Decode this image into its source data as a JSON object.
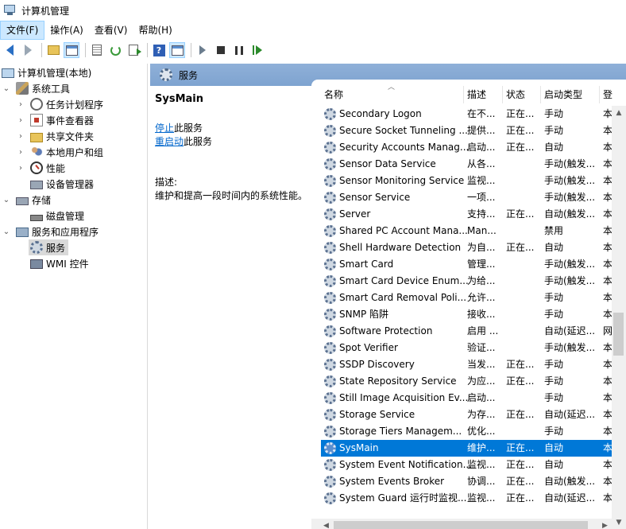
{
  "window": {
    "title": "计算机管理"
  },
  "menu": [
    {
      "label": "文件(F)",
      "active": true
    },
    {
      "label": "操作(A)",
      "active": false
    },
    {
      "label": "查看(V)",
      "active": false
    },
    {
      "label": "帮助(H)",
      "active": false
    }
  ],
  "toolbar": {
    "icons": [
      "back-arrow-icon",
      "forward-arrow-icon",
      "up-folder-icon",
      "show-hide-tree-icon",
      "properties-icon",
      "refresh-icon",
      "export-list-icon",
      "help-icon",
      "action-pane-icon",
      "start-service-icon",
      "stop-service-icon",
      "pause-service-icon",
      "restart-service-icon"
    ],
    "help_glyph": "?"
  },
  "tree": {
    "items": [
      {
        "label": "计算机管理(本地)",
        "icon": "computer-icon"
      },
      {
        "label": "系统工具",
        "icon": "tools-icon"
      },
      {
        "label": "任务计划程序",
        "icon": "clock-icon"
      },
      {
        "label": "事件查看器",
        "icon": "event-viewer-icon"
      },
      {
        "label": "共享文件夹",
        "icon": "shared-folder-icon"
      },
      {
        "label": "本地用户和组",
        "icon": "users-icon"
      },
      {
        "label": "性能",
        "icon": "performance-icon"
      },
      {
        "label": "设备管理器",
        "icon": "device-manager-icon"
      },
      {
        "label": "存储",
        "icon": "storage-icon"
      },
      {
        "label": "磁盘管理",
        "icon": "disk-icon"
      },
      {
        "label": "服务和应用程序",
        "icon": "apps-icon"
      },
      {
        "label": "服务",
        "icon": "gear-icon"
      },
      {
        "label": "WMI 控件",
        "icon": "wmi-icon"
      }
    ]
  },
  "services_panel": {
    "header_title": "服务",
    "selected_name": "SysMain",
    "stop_link": "停止",
    "stop_suffix": "此服务",
    "restart_link": "重启动",
    "restart_suffix": "此服务",
    "description_label": "描述:",
    "description_text": "维护和提高一段时间内的系统性能。"
  },
  "columns": {
    "name": "名称",
    "description": "描述",
    "status": "状态",
    "startup": "启动类型",
    "logon": "登"
  },
  "services": [
    {
      "name": "Secondary Logon",
      "desc": "在不...",
      "status": "正在...",
      "startup": "手动",
      "logon": "本"
    },
    {
      "name": "Secure Socket Tunneling ...",
      "desc": "提供...",
      "status": "正在...",
      "startup": "手动",
      "logon": "本"
    },
    {
      "name": "Security Accounts Manag...",
      "desc": "启动...",
      "status": "正在...",
      "startup": "自动",
      "logon": "本"
    },
    {
      "name": "Sensor Data Service",
      "desc": "从各...",
      "status": "",
      "startup": "手动(触发...",
      "logon": "本"
    },
    {
      "name": "Sensor Monitoring Service",
      "desc": "监视...",
      "status": "",
      "startup": "手动(触发...",
      "logon": "本"
    },
    {
      "name": "Sensor Service",
      "desc": "一项...",
      "status": "",
      "startup": "手动(触发...",
      "logon": "本"
    },
    {
      "name": "Server",
      "desc": "支持...",
      "status": "正在...",
      "startup": "自动(触发...",
      "logon": "本"
    },
    {
      "name": "Shared PC Account Mana...",
      "desc": "Man...",
      "status": "",
      "startup": "禁用",
      "logon": "本"
    },
    {
      "name": "Shell Hardware Detection",
      "desc": "为自...",
      "status": "正在...",
      "startup": "自动",
      "logon": "本"
    },
    {
      "name": "Smart Card",
      "desc": "管理...",
      "status": "",
      "startup": "手动(触发...",
      "logon": "本"
    },
    {
      "name": "Smart Card Device Enum...",
      "desc": "为给...",
      "status": "",
      "startup": "手动(触发...",
      "logon": "本"
    },
    {
      "name": "Smart Card Removal Poli...",
      "desc": "允许...",
      "status": "",
      "startup": "手动",
      "logon": "本"
    },
    {
      "name": "SNMP 陷阱",
      "desc": "接收...",
      "status": "",
      "startup": "手动",
      "logon": "本"
    },
    {
      "name": "Software Protection",
      "desc": "启用 ...",
      "status": "",
      "startup": "自动(延迟...",
      "logon": "网"
    },
    {
      "name": "Spot Verifier",
      "desc": "验证...",
      "status": "",
      "startup": "手动(触发...",
      "logon": "本"
    },
    {
      "name": "SSDP Discovery",
      "desc": "当发...",
      "status": "正在...",
      "startup": "手动",
      "logon": "本"
    },
    {
      "name": "State Repository Service",
      "desc": "为应...",
      "status": "正在...",
      "startup": "手动",
      "logon": "本"
    },
    {
      "name": "Still Image Acquisition Ev...",
      "desc": "启动...",
      "status": "",
      "startup": "手动",
      "logon": "本"
    },
    {
      "name": "Storage Service",
      "desc": "为存...",
      "status": "正在...",
      "startup": "自动(延迟...",
      "logon": "本"
    },
    {
      "name": "Storage Tiers Managem...",
      "desc": "优化...",
      "status": "",
      "startup": "手动",
      "logon": "本"
    },
    {
      "name": "SysMain",
      "desc": "维护...",
      "status": "正在...",
      "startup": "自动",
      "logon": "本",
      "selected": true
    },
    {
      "name": "System Event Notification...",
      "desc": "监视...",
      "status": "正在...",
      "startup": "自动",
      "logon": "本"
    },
    {
      "name": "System Events Broker",
      "desc": "协调...",
      "status": "正在...",
      "startup": "自动(触发...",
      "logon": "本"
    },
    {
      "name": "System Guard 运行时监视...",
      "desc": "监视...",
      "status": "正在...",
      "startup": "自动(延迟...",
      "logon": "本"
    }
  ],
  "colors": {
    "selection": "#0078d7",
    "header_band": "#8fb0d8",
    "link": "#0066cc"
  }
}
